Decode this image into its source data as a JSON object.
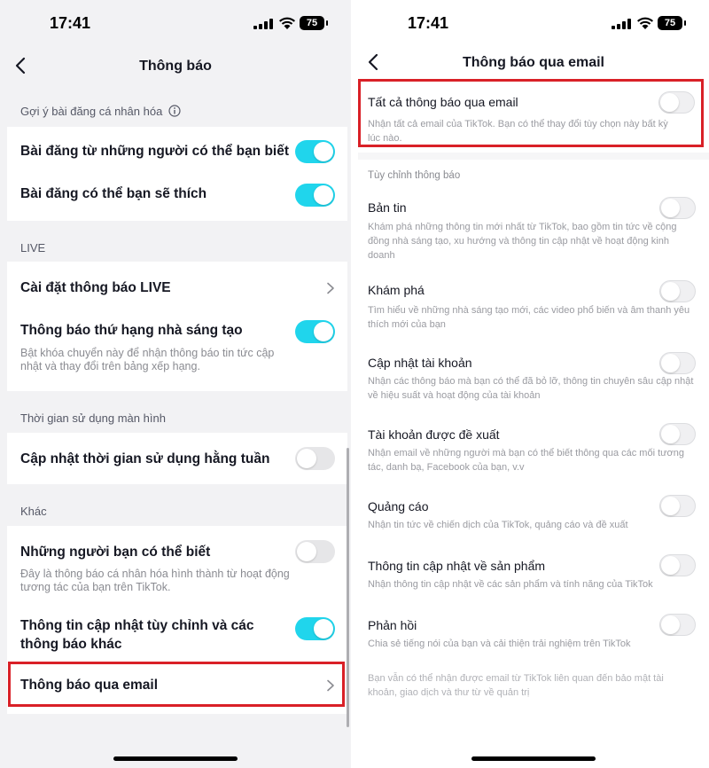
{
  "colors": {
    "accent": "#20d5ec",
    "highlight": "#d92027"
  },
  "left": {
    "status": {
      "time": "17:41",
      "battery": "75"
    },
    "title": "Thông báo",
    "sections": {
      "personalized": "Gợi ý bài đăng cá nhân hóa",
      "live": "LIVE",
      "screen_time": "Thời gian sử dụng màn hình",
      "other": "Khác"
    },
    "rows": {
      "people_you_may_know_posts": {
        "label": "Bài đăng từ những người có thể bạn biết",
        "toggle": true
      },
      "posts_you_may_like": {
        "label": "Bài đăng có thể bạn sẽ thích",
        "toggle": true
      },
      "live_settings": {
        "label": "Cài đặt thông báo LIVE"
      },
      "creator_rank": {
        "label": "Thông báo thứ hạng nhà sáng tạo",
        "desc": "Bật khóa chuyển này để nhận thông báo tin tức cập nhật và thay đổi trên bảng xếp hạng.",
        "toggle": true
      },
      "weekly_screen_time": {
        "label": "Cập nhật thời gian sử dụng hằng tuần",
        "toggle": false
      },
      "friends_suggest": {
        "label": "Những người bạn có thể biết",
        "desc": "Đây là thông báo cá nhân hóa hình thành từ hoạt động tương tác của bạn trên TikTok.",
        "toggle": false
      },
      "custom_updates": {
        "label": "Thông tin cập nhật tùy chỉnh và các thông báo khác",
        "toggle": true
      },
      "email_notifications": {
        "label": "Thông báo qua email"
      }
    }
  },
  "right": {
    "status": {
      "time": "17:41",
      "battery": "75"
    },
    "title": "Thông báo qua email",
    "all": {
      "label": "Tất cả thông báo qua email",
      "desc": "Nhận tất cả email của TikTok. Bạn có thể thay đổi tùy chọn này bất kỳ lúc nào.",
      "toggle": false
    },
    "custom_section": "Tùy chỉnh thông báo",
    "items": [
      {
        "label": "Bản tin",
        "desc": "Khám phá những thông tin mới nhất từ TikTok, bao gồm tin tức về cộng đồng nhà sáng tạo, xu hướng và thông tin cập nhật về hoạt động kinh doanh",
        "toggle": false
      },
      {
        "label": "Khám phá",
        "desc": "Tìm hiểu về những nhà sáng tạo mới, các video phổ biến và âm thanh yêu thích mới của bạn",
        "toggle": false
      },
      {
        "label": "Cập nhật tài khoản",
        "desc": "Nhận các thông báo mà bạn có thể đã bỏ lỡ, thông tin chuyên sâu cập nhật về hiệu suất và hoạt động của tài khoản",
        "toggle": false
      },
      {
        "label": "Tài khoản được đề xuất",
        "desc": "Nhận email về những người mà bạn có thể biết thông qua các mối tương tác, danh bạ, Facebook của bạn, v.v",
        "toggle": false
      },
      {
        "label": "Quảng cáo",
        "desc": "Nhận tin tức về chiến dịch của TikTok, quảng cáo và đề xuất",
        "toggle": false
      },
      {
        "label": "Thông tin cập nhật về sản phẩm",
        "desc": "Nhận thông tin cập nhật về các sản phẩm và tính năng của TikTok",
        "toggle": false
      },
      {
        "label": "Phản hồi",
        "desc": "Chia sẻ tiếng nói của bạn và cải thiện trải nghiệm trên TikTok",
        "toggle": false
      }
    ],
    "footer": "Bạn vẫn có thể nhận được email từ TikTok liên quan đến bảo mật tài khoản, giao dịch và thư từ về quản trị"
  }
}
